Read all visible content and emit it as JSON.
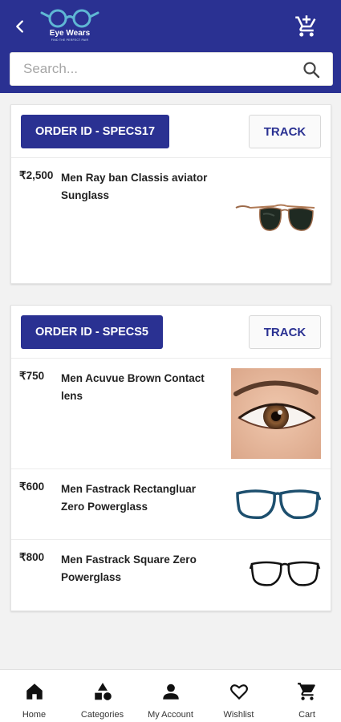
{
  "header": {
    "brand_name": "Eye Wears",
    "brand_tagline": "FIND THE PERFECT PAIR",
    "colors": {
      "primary": "#2a3192",
      "logo_teal": "#5fb7d4"
    }
  },
  "search": {
    "placeholder": "Search..."
  },
  "orders": [
    {
      "order_label": "ORDER ID - SPECS17",
      "track_label": "TRACK",
      "items": [
        {
          "price": "₹2,500",
          "name": "Men Ray ban Classis aviator Sunglass",
          "image": "aviator-sunglass"
        }
      ]
    },
    {
      "order_label": "ORDER ID - SPECS5",
      "track_label": "TRACK",
      "items": [
        {
          "price": "₹750",
          "name": "Men Acuvue Brown Contact lens",
          "image": "brown-eye-contact-lens"
        },
        {
          "price": "₹600",
          "name": "Men Fastrack Rectangluar Zero Powerglass",
          "image": "rectangular-glasses"
        },
        {
          "price": "₹800",
          "name": "Men Fastrack Square Zero Powerglass",
          "image": "square-glasses"
        }
      ]
    }
  ],
  "bottom_nav": [
    {
      "label": "Home",
      "icon": "home-icon"
    },
    {
      "label": "Categories",
      "icon": "categories-icon"
    },
    {
      "label": "My Account",
      "icon": "account-icon"
    },
    {
      "label": "Wishlist",
      "icon": "heart-icon"
    },
    {
      "label": "Cart",
      "icon": "cart-icon"
    }
  ]
}
